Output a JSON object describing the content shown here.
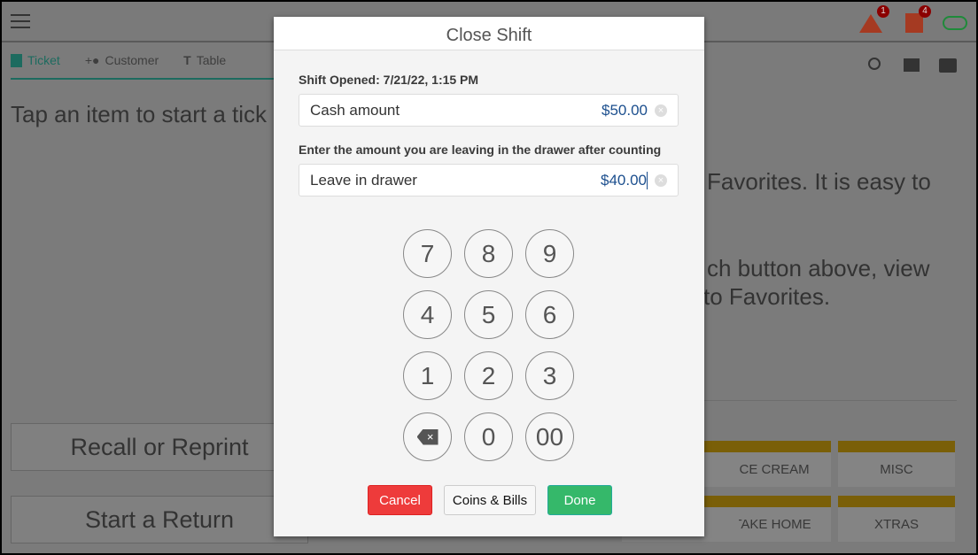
{
  "header": {
    "alerts_badge": "1",
    "tickets_badge": "4",
    "colors": {
      "alert": "#a53a22",
      "cloud": "#1f8a3a",
      "badge": "#8b0000"
    }
  },
  "tabs": [
    {
      "label": "Ticket",
      "icon": "ticket-icon"
    },
    {
      "label": "Customer",
      "icon": "add-person-icon"
    },
    {
      "label": "Table",
      "icon": "table-icon"
    }
  ],
  "left": {
    "prompt": "Tap an item to start a tick",
    "recall": "Recall or Reprint",
    "return": "Start a Return"
  },
  "right": {
    "line1": "Favorites. It is easy to",
    "line2": "ch button above, view",
    "line3": "to Favorites."
  },
  "tiles": [
    "ICE CREAM",
    "MISC",
    "TAKE HOME",
    "XTRAS"
  ],
  "dialog": {
    "title": "Close Shift",
    "shift_opened": "Shift Opened: 7/21/22, 1:15 PM",
    "cash_label": "Cash amount",
    "cash_value": "$50.00",
    "instruction": "Enter the amount you are leaving in the drawer after counting",
    "leave_label": "Leave in drawer",
    "leave_value": "$40.00",
    "keys": [
      "7",
      "8",
      "9",
      "4",
      "5",
      "6",
      "1",
      "2",
      "3",
      "",
      "0",
      "00"
    ],
    "cancel": "Cancel",
    "coins": "Coins & Bills",
    "done": "Done"
  }
}
